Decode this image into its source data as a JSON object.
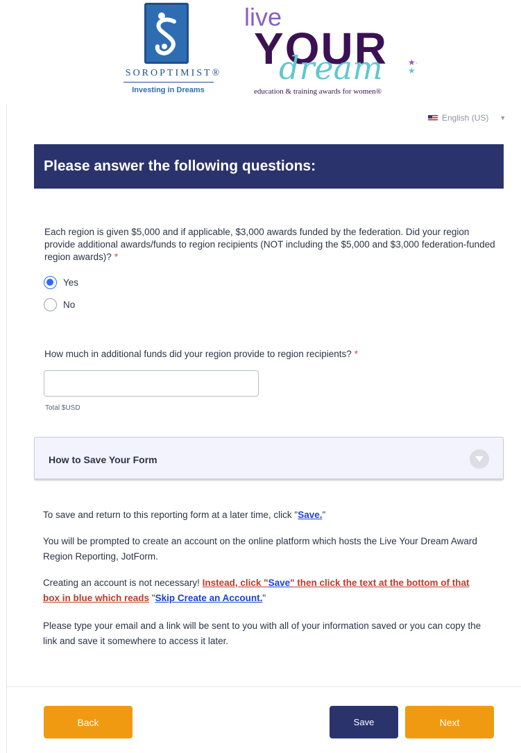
{
  "header": {
    "soroptimist": {
      "name": "SOROPTIMIST®",
      "tagline": "Investing in Dreams"
    },
    "live_your_dream": {
      "live": "live",
      "your": "YOUR",
      "dream": "dream",
      "tagline": "education & training awards for women®"
    }
  },
  "language": {
    "selected": "English (US)"
  },
  "section": {
    "title": "Please answer the following questions:"
  },
  "question1": {
    "text": "Each region is given $5,000 and if applicable, $3,000 awards funded by the federation. Did your region provide additional awards/funds to region recipients (NOT including the $5,000 and $3,000 federation-funded region awards)?",
    "required_mark": "*",
    "options": [
      {
        "label": "Yes",
        "checked": true
      },
      {
        "label": "No",
        "checked": false
      }
    ]
  },
  "question2": {
    "text": "How much in additional funds did your region provide to region recipients?",
    "required_mark": "*",
    "value": "",
    "sublabel": "Total $USD"
  },
  "collapse": {
    "title": "How to Save Your Form"
  },
  "info": {
    "p1_before": "To save and return to this reporting form at a later time, click \"",
    "p1_link": "Save.",
    "p1_after": "\"",
    "p2": "You will be prompted to create an account on the online platform which hosts the Live Your Dream Award Region Reporting, JotForm.",
    "p3_before": "Creating an account is not necessary! ",
    "p3_red1": "Instead, click \"",
    "p3_link1": "Save",
    "p3_red2": "\" then click the text at the bottom of that box in blue which reads",
    "p3_quote_open": " \"",
    "p3_link2": "Skip Create an Account.",
    "p3_quote_close": "\"",
    "p4": "Please type your email and a link will be sent to you with all of your information saved or you can copy the link and save it somewhere to access it later."
  },
  "buttons": {
    "back": "Back",
    "save": "Save",
    "next": "Next"
  },
  "colors": {
    "header_bg": "#2a336b",
    "accent_orange": "#f09a11",
    "radio_blue": "#2e69ff",
    "required_red": "#f23a3c",
    "link_blue": "#1b3fd6",
    "link_red": "#c0392b"
  },
  "icons": {
    "language_flag": "us-flag-icon",
    "language_caret": "caret-down-icon",
    "collapse_toggle": "chevron-down-icon",
    "soroptimist_logo": "soroptimist-s-icon"
  }
}
